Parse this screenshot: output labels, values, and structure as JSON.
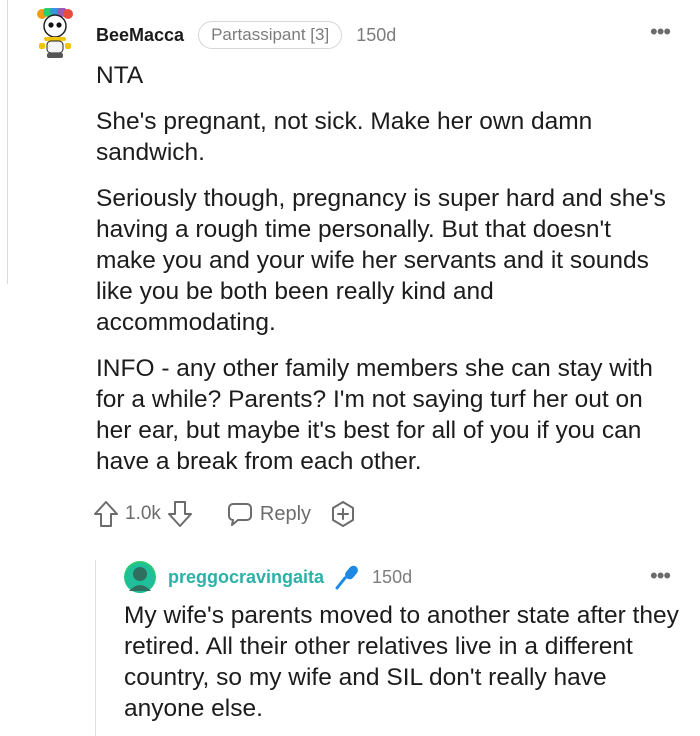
{
  "comment": {
    "username": "BeeMacca",
    "flair": "Partassipant [3]",
    "time": "150d",
    "paragraphs": [
      "NTA",
      "She's pregnant, not sick. Make her own damn sandwich.",
      "Seriously though, pregnancy is super hard and she's having a rough time personally. But that doesn't make you and your wife her servants and it sounds like you be both been really kind and accommodating.",
      "INFO - any other family members she can stay with for a while? Parents? I'm not saying turf her out on her ear, but maybe it's best for all of you if you can have a break from each other."
    ],
    "votes": "1.0k",
    "reply_label": "Reply"
  },
  "reply": {
    "username": "preggocravingaita",
    "time": "150d",
    "text": "My wife's parents moved to another state after they retired. All their other relatives live in a different country, so my wife and SIL don't really have anyone else."
  },
  "icons": {
    "upvote": "upvote-arrow-icon",
    "downvote": "downvote-arrow-icon",
    "reply": "speech-bubble-icon",
    "award": "award-plus-icon",
    "more": "more-dots-icon",
    "mic": "microphone-icon"
  },
  "colors": {
    "reply_username": "#2cb1a8",
    "meta_gray": "#7c7c7c",
    "text": "#1c1c1c"
  }
}
